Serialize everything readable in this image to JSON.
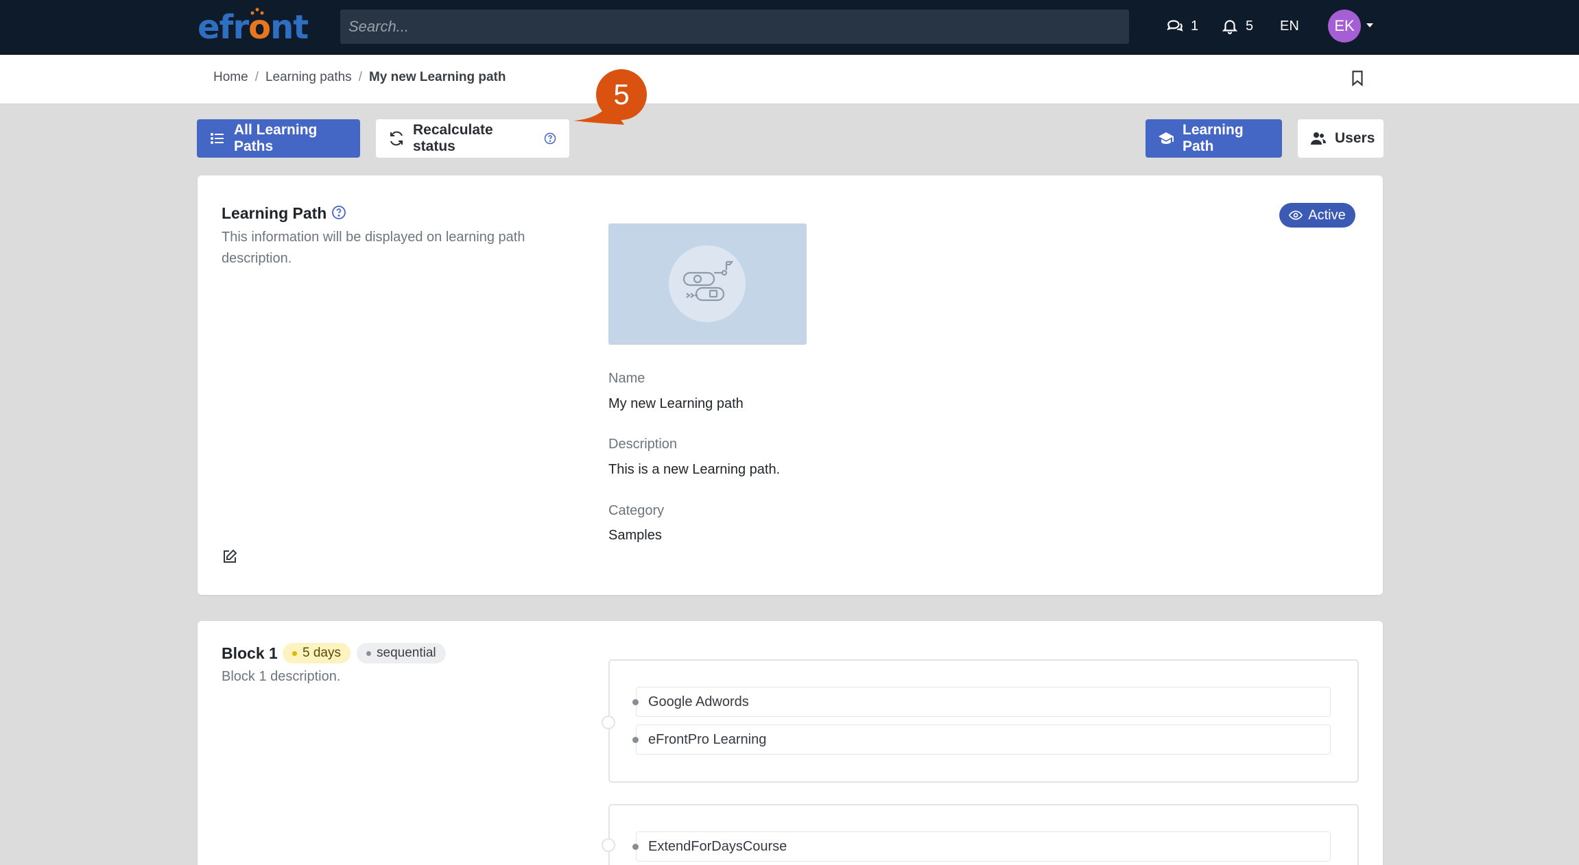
{
  "app": {
    "logo_prefix": "efr",
    "logo_o": "o",
    "logo_suffix": "nt"
  },
  "nav": {
    "search_placeholder": "Search...",
    "messages_count": "1",
    "notifications_count": "5",
    "language": "EN",
    "avatar_initials": "EK"
  },
  "breadcrumb": {
    "home": "Home",
    "learning_paths": "Learning paths",
    "current": "My new Learning path",
    "separator": "/"
  },
  "toolbar": {
    "all_learning_paths": "All Learning Paths",
    "recalculate_status": "Recalculate status",
    "learning_path": "Learning Path",
    "users": "Users"
  },
  "step_marker": {
    "number": "5",
    "color": "#d9520f"
  },
  "details": {
    "title": "Learning Path",
    "description": "This information will be displayed on learning path description.",
    "status_badge": "Active",
    "name_label": "Name",
    "name_value": "My new Learning path",
    "description_label": "Description",
    "description_value": "This is a new Learning path.",
    "category_label": "Category",
    "category_value": "Samples"
  },
  "block1": {
    "title": "Block 1",
    "duration_pill": "5 days",
    "mode_pill": "sequential",
    "description": "Block 1 description.",
    "groups": [
      {
        "courses": [
          "Google Adwords",
          "eFrontPro Learning"
        ]
      },
      {
        "courses": [
          "ExtendForDaysCourse"
        ]
      }
    ]
  },
  "colors": {
    "navbar": "#0e1b2b",
    "primary": "#4466c4",
    "active_badge": "#3b5ab4",
    "page_bg": "#dcdcdc"
  }
}
